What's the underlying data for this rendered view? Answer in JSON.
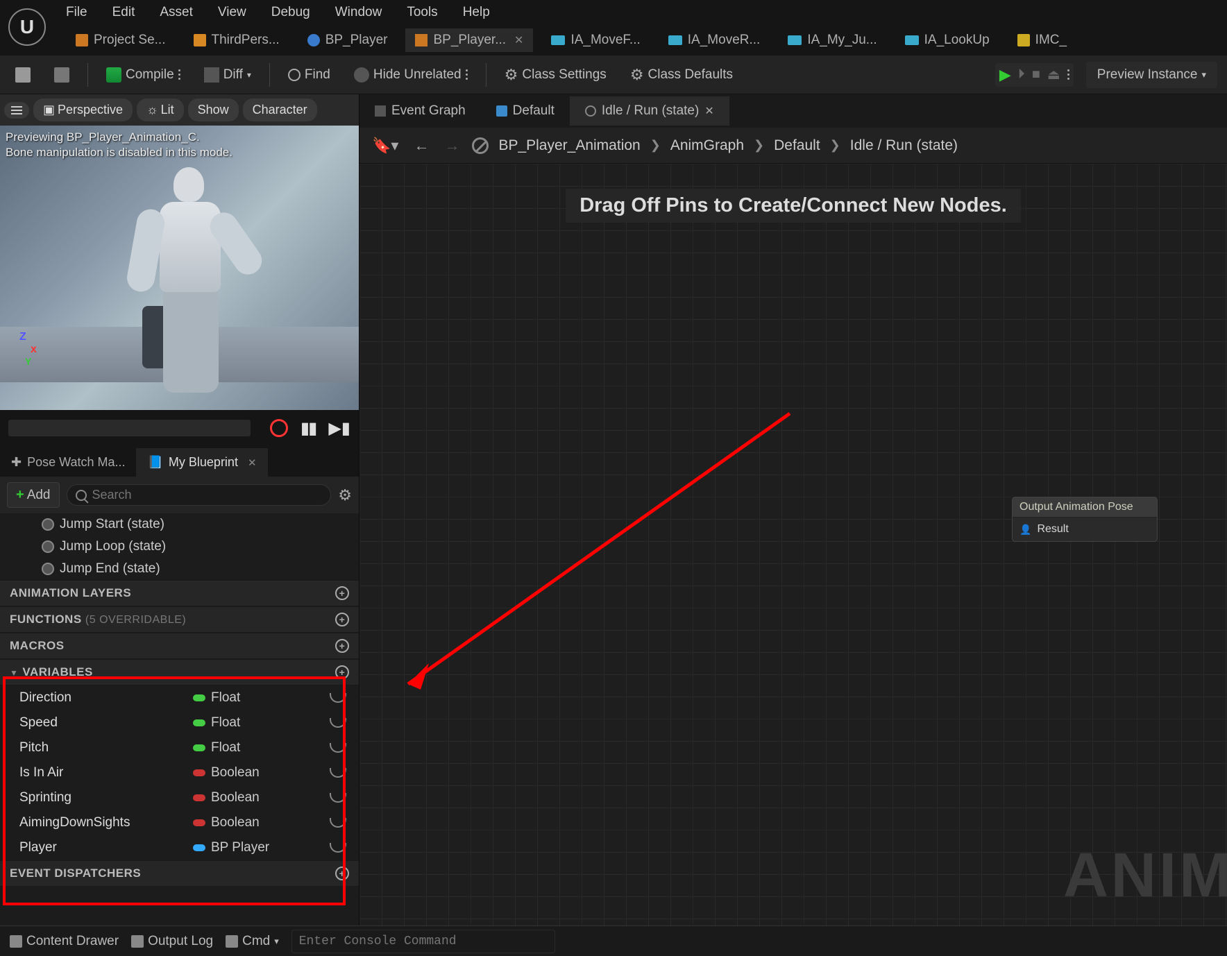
{
  "menu": [
    "File",
    "Edit",
    "Asset",
    "View",
    "Debug",
    "Window",
    "Tools",
    "Help"
  ],
  "docTabs": [
    {
      "label": "Project Se...",
      "icon": "project"
    },
    {
      "label": "ThirdPers...",
      "icon": "map"
    },
    {
      "label": "BP_Player",
      "icon": "bp-pawn"
    },
    {
      "label": "BP_Player...",
      "icon": "bp-anim",
      "active": true,
      "closable": true
    },
    {
      "label": "IA_MoveF...",
      "icon": "ia"
    },
    {
      "label": "IA_MoveR...",
      "icon": "ia"
    },
    {
      "label": "IA_My_Ju...",
      "icon": "ia"
    },
    {
      "label": "IA_LookUp",
      "icon": "ia"
    },
    {
      "label": "IMC_",
      "icon": "imc"
    }
  ],
  "toolbar": {
    "compile": "Compile",
    "diff": "Diff",
    "find": "Find",
    "hide": "Hide Unrelated",
    "class_settings": "Class Settings",
    "class_defaults": "Class Defaults",
    "preview": "Preview Instance"
  },
  "viewport": {
    "buttons": {
      "perspective": "Perspective",
      "lit": "Lit",
      "show": "Show",
      "character": "Character"
    },
    "msg1": "Previewing BP_Player_Animation_C.",
    "msg2": "Bone manipulation is disabled in this mode."
  },
  "subtabs": {
    "pose": "Pose Watch Ma...",
    "mybp": "My Blueprint"
  },
  "addsearch": {
    "add": "Add",
    "placeholder": "Search"
  },
  "states": [
    "Jump Start (state)",
    "Jump Loop (state)",
    "Jump End (state)"
  ],
  "sections": {
    "anim_layers": "ANIMATION LAYERS",
    "functions": "FUNCTIONS",
    "functions_sub": "(5 OVERRIDABLE)",
    "macros": "MACROS",
    "variables": "VARIABLES",
    "event_dispatchers": "EVENT DISPATCHERS"
  },
  "variables": [
    {
      "name": "Direction",
      "type": "Float",
      "pill": "green"
    },
    {
      "name": "Speed",
      "type": "Float",
      "pill": "green"
    },
    {
      "name": "Pitch",
      "type": "Float",
      "pill": "green"
    },
    {
      "name": "Is In Air",
      "type": "Boolean",
      "pill": "red"
    },
    {
      "name": "Sprinting",
      "type": "Boolean",
      "pill": "red"
    },
    {
      "name": "AimingDownSights",
      "type": "Boolean",
      "pill": "red"
    },
    {
      "name": "Player",
      "type": "BP Player",
      "pill": "blue"
    }
  ],
  "graphTabs": [
    {
      "label": "Event Graph",
      "icon": "event"
    },
    {
      "label": "Default",
      "icon": "default"
    },
    {
      "label": "Idle / Run (state)",
      "icon": "node",
      "active": true,
      "closable": true
    }
  ],
  "breadcrumb": {
    "root": "BP_Player_Animation",
    "items": [
      "AnimGraph",
      "Default",
      "Idle / Run (state)"
    ]
  },
  "graph": {
    "hint": "Drag Off Pins to Create/Connect New Nodes.",
    "watermark": "ANIM",
    "output_node": {
      "title": "Output Animation Pose",
      "pin": "Result"
    }
  },
  "status": {
    "content_drawer": "Content Drawer",
    "output_log": "Output Log",
    "cmd": "Cmd",
    "console_placeholder": "Enter Console Command"
  }
}
